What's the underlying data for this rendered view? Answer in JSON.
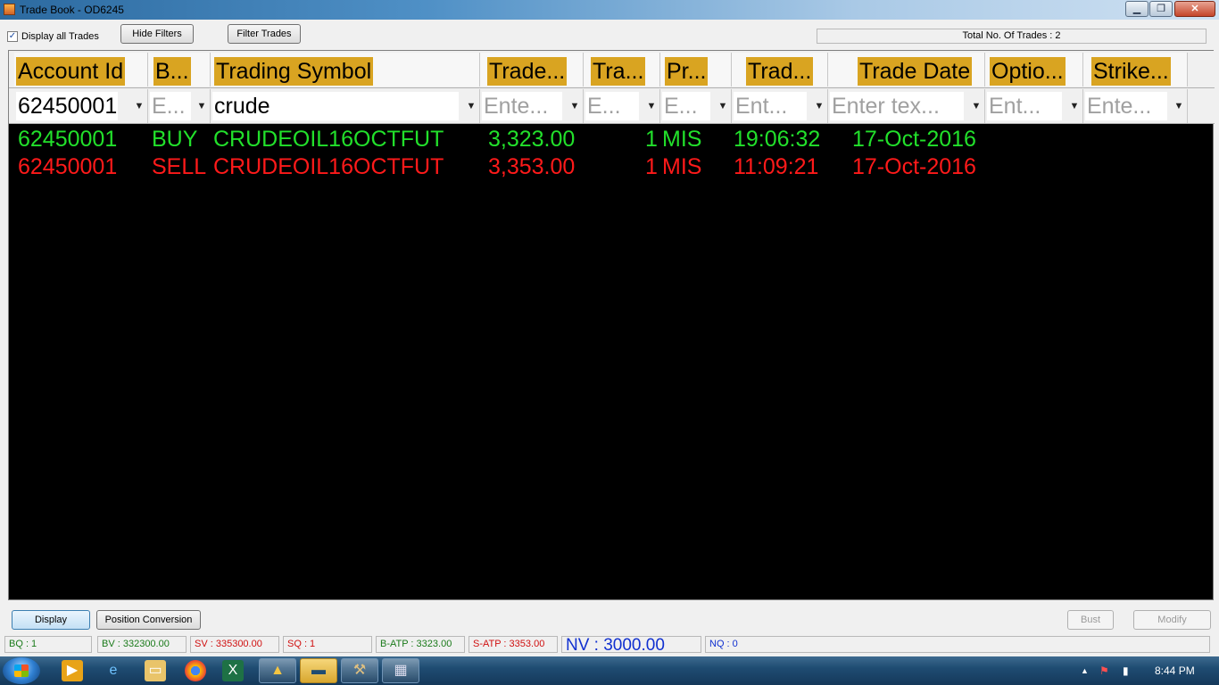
{
  "window": {
    "title": "Trade Book - OD6245",
    "minimize": "▁",
    "maximize": "❐",
    "close": "✕"
  },
  "toolbar": {
    "display_all_label": "Display all Trades",
    "display_all_checked": true,
    "hide_filters_label": "Hide Filters",
    "filter_trades_label": "Filter Trades",
    "total_trades": "Total No. Of Trades : 2"
  },
  "columns": [
    {
      "header": "Account Id",
      "filter_value": "62450001",
      "filter_placeholder": ""
    },
    {
      "header": "B...",
      "filter_value": "",
      "filter_placeholder": "E..."
    },
    {
      "header": "Trading Symbol",
      "filter_value": "crude",
      "filter_placeholder": ""
    },
    {
      "header": "Trade...",
      "filter_value": "",
      "filter_placeholder": "Ente..."
    },
    {
      "header": "Tra...",
      "filter_value": "",
      "filter_placeholder": "E..."
    },
    {
      "header": "Pr...",
      "filter_value": "",
      "filter_placeholder": "E..."
    },
    {
      "header": "Trad...",
      "filter_value": "",
      "filter_placeholder": "Ent..."
    },
    {
      "header": "Trade Date",
      "filter_value": "",
      "filter_placeholder": "Enter tex..."
    },
    {
      "header": "Optio...",
      "filter_value": "",
      "filter_placeholder": "Ent..."
    },
    {
      "header": "Strike...",
      "filter_value": "",
      "filter_placeholder": "Ente..."
    }
  ],
  "trades": [
    {
      "side_color": "#22e02b",
      "account": "62450001",
      "side": "BUY",
      "symbol": "CRUDEOIL16OCTFUT",
      "price": "3,323.00",
      "qty": "1",
      "product": "MIS",
      "time": "19:06:32",
      "date": "17-Oct-2016"
    },
    {
      "side_color": "#ff1a1a",
      "account": "62450001",
      "side": "SELL",
      "symbol": "CRUDEOIL16OCTFUT",
      "price": "3,353.00",
      "qty": "1",
      "product": "MIS",
      "time": "11:09:21",
      "date": "17-Oct-2016"
    }
  ],
  "actions": {
    "display_label": "Display",
    "position_conversion_label": "Position Conversion",
    "bust_label": "Bust",
    "modify_label": "Modify"
  },
  "status": {
    "bq": "BQ : 1",
    "bv": "BV : 332300.00",
    "sv": "SV : 335300.00",
    "sq": "SQ : 1",
    "batp": "B-ATP : 3323.00",
    "satp": "S-ATP : 3353.00",
    "nv": "NV : 3000.00",
    "nq": "NQ : 0",
    "buy_color": "#1a7a1a",
    "sell_color": "#d01010",
    "net_color": "#1030d0"
  },
  "taskbar": {
    "clock": "8:44 PM",
    "tray_arrow": "▲"
  }
}
